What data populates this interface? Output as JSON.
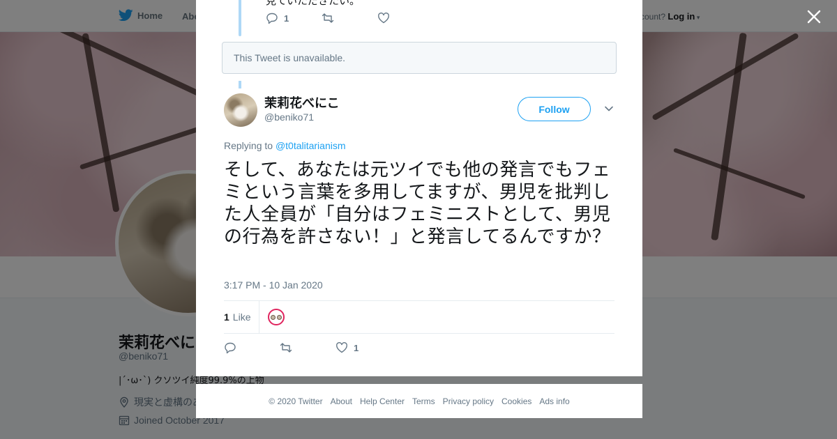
{
  "nav": {
    "home_label": "Home",
    "about_label": "Abo",
    "account_prompt": "ccount?",
    "login_label": "Log in"
  },
  "profile": {
    "name": "茉莉花べにこ",
    "handle": "@beniko71",
    "bio": "|´･ω･`) クソツイ純度99.9%の上物",
    "location": "現実と虚構のあ",
    "joined": "Joined October 2017"
  },
  "previous_tweet": {
    "text_fragment": "見ていただきたい。",
    "reply_count": "1"
  },
  "unavailable_notice": "This Tweet is unavailable.",
  "tweet": {
    "author_name": "茉莉花べにこ",
    "author_handle": "@beniko71",
    "follow_label": "Follow",
    "replying_prefix": "Replying to",
    "replying_to": "@t0talitarianism",
    "text": "そして、あなたは元ツイでも他の発言でもフェミという言葉を多用してますが、男児を批判した人全員が「自分はフェミニストとして、男児の行為を許さない！」と発言してるんですか？",
    "timestamp": "3:17 PM - 10 Jan 2020",
    "like_count": "1",
    "like_label": "Like",
    "action_like_count": "1"
  },
  "footer": {
    "copyright": "© 2020 Twitter",
    "links": [
      "About",
      "Help Center",
      "Terms",
      "Privacy policy",
      "Cookies",
      "Ads info"
    ]
  },
  "colors": {
    "accent": "#1da1f2",
    "muted_text": "#657786",
    "like_red": "#e0245e"
  },
  "icons": [
    "twitter-bird-icon",
    "close-icon",
    "reply-icon",
    "retweet-icon",
    "heart-icon",
    "chevron-down-icon",
    "location-icon",
    "calendar-icon"
  ]
}
